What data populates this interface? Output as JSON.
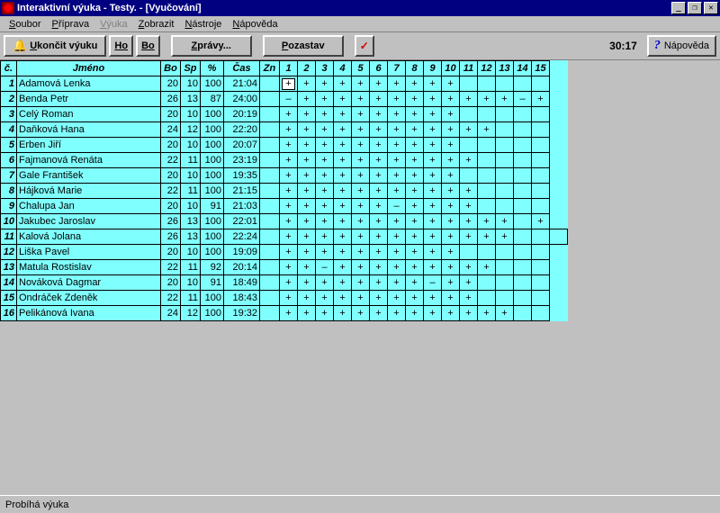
{
  "title": "Interaktivní výuka - Testy. - [Vyučování]",
  "menu": {
    "soubor": "Soubor",
    "priprava": "Příprava",
    "vyuka": "Výuka",
    "zobrazit": "Zobrazit",
    "nastroje": "Nástroje",
    "napoveda": "Nápověda"
  },
  "toolbar": {
    "ukoncit": "Ukončit výuku",
    "ho": "Ho",
    "bo": "Bo",
    "zpravy": "Zprávy...",
    "pozastav": "Pozastav",
    "napoveda": "Nápověda"
  },
  "time": "30:17",
  "headers": {
    "c": "č.",
    "jmeno": "Jméno",
    "bo": "Bo",
    "sp": "Sp",
    "pct": "%",
    "cas": "Čas",
    "zn": "Zn"
  },
  "qcols": [
    "1",
    "2",
    "3",
    "4",
    "5",
    "6",
    "7",
    "8",
    "9",
    "10",
    "11",
    "12",
    "13",
    "14",
    "15"
  ],
  "students": [
    {
      "n": "1",
      "name": "Adamová Lenka",
      "bo": "20",
      "sp": "10",
      "pct": "100",
      "cas": "21:04",
      "q": [
        "+",
        "+",
        "+",
        "+",
        "+",
        "+",
        "+",
        "+",
        "+",
        "+",
        "",
        "",
        "",
        "",
        ""
      ]
    },
    {
      "n": "2",
      "name": "Benda Petr",
      "bo": "26",
      "sp": "13",
      "pct": "87",
      "cas": "24:00",
      "q": [
        "–",
        "+",
        "+",
        "+",
        "+",
        "+",
        "+",
        "+",
        "+",
        "+",
        "+",
        "+",
        "+",
        "–",
        "+"
      ]
    },
    {
      "n": "3",
      "name": "Celý Roman",
      "bo": "20",
      "sp": "10",
      "pct": "100",
      "cas": "20:19",
      "q": [
        "+",
        "+",
        "+",
        "+",
        "+",
        "+",
        "+",
        "+",
        "+",
        "+",
        "",
        "",
        "",
        "",
        ""
      ]
    },
    {
      "n": "4",
      "name": "Daňková Hana",
      "bo": "24",
      "sp": "12",
      "pct": "100",
      "cas": "22:20",
      "q": [
        "+",
        "+",
        "+",
        "+",
        "+",
        "+",
        "+",
        "+",
        "+",
        "+",
        "+",
        "+",
        "",
        "",
        ""
      ]
    },
    {
      "n": "5",
      "name": "Erben Jiří",
      "bo": "20",
      "sp": "10",
      "pct": "100",
      "cas": "20:07",
      "q": [
        "+",
        "+",
        "+",
        "+",
        "+",
        "+",
        "+",
        "+",
        "+",
        "+",
        "",
        "",
        "",
        "",
        ""
      ]
    },
    {
      "n": "6",
      "name": "Fajmanová Renáta",
      "bo": "22",
      "sp": "11",
      "pct": "100",
      "cas": "23:19",
      "q": [
        "+",
        "+",
        "+",
        "+",
        "+",
        "+",
        "+",
        "+",
        "+",
        "+",
        "+",
        "",
        "",
        "",
        ""
      ]
    },
    {
      "n": "7",
      "name": "Gale František",
      "bo": "20",
      "sp": "10",
      "pct": "100",
      "cas": "19:35",
      "q": [
        "+",
        "+",
        "+",
        "+",
        "+",
        "+",
        "+",
        "+",
        "+",
        "+",
        "",
        "",
        "",
        "",
        ""
      ]
    },
    {
      "n": "8",
      "name": "Hájková Marie",
      "bo": "22",
      "sp": "11",
      "pct": "100",
      "cas": "21:15",
      "q": [
        "+",
        "+",
        "+",
        "+",
        "+",
        "+",
        "+",
        "+",
        "+",
        "+",
        "+",
        "",
        "",
        "",
        ""
      ]
    },
    {
      "n": "9",
      "name": "Chalupa Jan",
      "bo": "20",
      "sp": "10",
      "pct": "91",
      "cas": "21:03",
      "q": [
        "+",
        "+",
        "+",
        "+",
        "+",
        "+",
        "–",
        "+",
        "+",
        "+",
        "+",
        "",
        "",
        "",
        ""
      ]
    },
    {
      "n": "10",
      "name": "Jakubec Jaroslav",
      "bo": "26",
      "sp": "13",
      "pct": "100",
      "cas": "22:01",
      "q": [
        "+",
        "+",
        "+",
        "+",
        "+",
        "+",
        "+",
        "+",
        "+",
        "+",
        "+",
        "+",
        "+",
        "",
        "+"
      ]
    },
    {
      "n": "11",
      "name": "Kalová Jolana",
      "bo": "26",
      "sp": "13",
      "pct": "100",
      "cas": "22:24",
      "q": [
        "+",
        "+",
        "+",
        "+",
        "+",
        "+",
        "+",
        "+",
        "+",
        "+",
        "+",
        "+",
        "+",
        "",
        "",
        ""
      ]
    },
    {
      "n": "12",
      "name": "Liška Pavel",
      "bo": "20",
      "sp": "10",
      "pct": "100",
      "cas": "19:09",
      "q": [
        "+",
        "+",
        "+",
        "+",
        "+",
        "+",
        "+",
        "+",
        "+",
        "+",
        "",
        "",
        "",
        "",
        ""
      ]
    },
    {
      "n": "13",
      "name": "Matula Rostislav",
      "bo": "22",
      "sp": "11",
      "pct": "92",
      "cas": "20:14",
      "q": [
        "+",
        "+",
        "–",
        "+",
        "+",
        "+",
        "+",
        "+",
        "+",
        "+",
        "+",
        "+",
        "",
        "",
        ""
      ]
    },
    {
      "n": "14",
      "name": "Nováková Dagmar",
      "bo": "20",
      "sp": "10",
      "pct": "91",
      "cas": "18:49",
      "q": [
        "+",
        "+",
        "+",
        "+",
        "+",
        "+",
        "+",
        "+",
        "–",
        "+",
        "+",
        "",
        "",
        "",
        ""
      ]
    },
    {
      "n": "15",
      "name": "Ondráček Zdeněk",
      "bo": "22",
      "sp": "11",
      "pct": "100",
      "cas": "18:43",
      "q": [
        "+",
        "+",
        "+",
        "+",
        "+",
        "+",
        "+",
        "+",
        "+",
        "+",
        "+",
        "",
        "",
        "",
        ""
      ]
    },
    {
      "n": "16",
      "name": "Pelikánová Ivana",
      "bo": "24",
      "sp": "12",
      "pct": "100",
      "cas": "19:32",
      "q": [
        "+",
        "+",
        "+",
        "+",
        "+",
        "+",
        "+",
        "+",
        "+",
        "+",
        "+",
        "+",
        "+",
        "",
        ""
      ]
    }
  ],
  "status": "Probíhá výuka"
}
